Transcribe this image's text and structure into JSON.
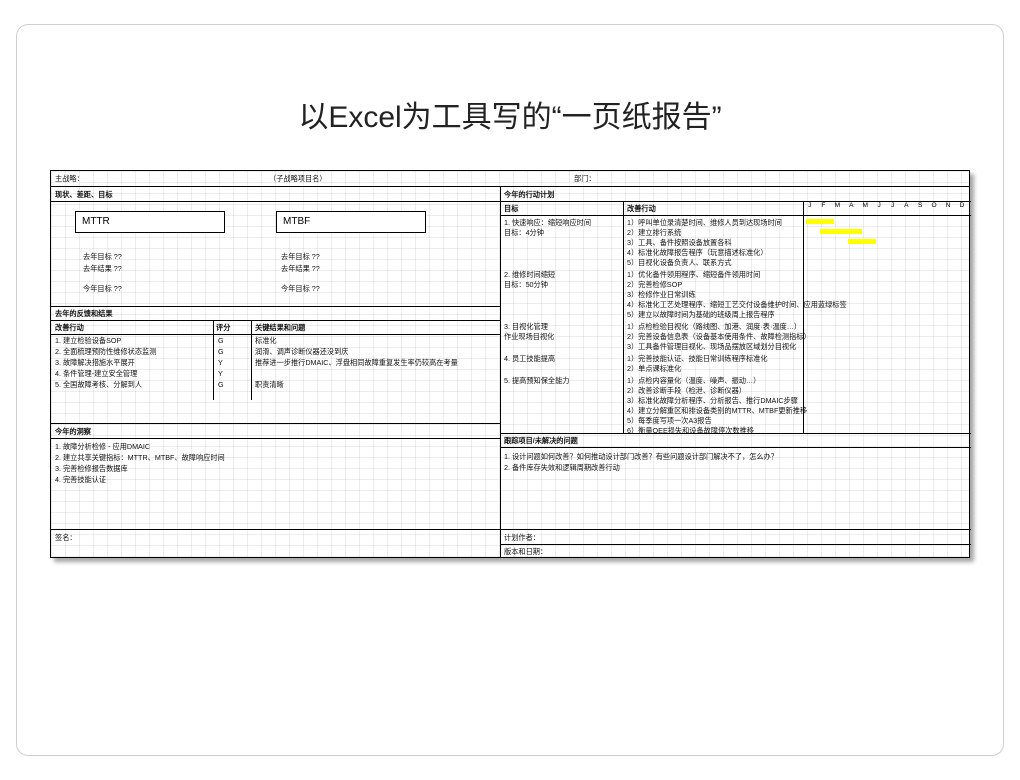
{
  "title": "以Excel为工具写的“一页纸报告”",
  "header": {
    "strategy_label": "主战略：",
    "strategy_value": "（子战略项目名）",
    "dept_label": "部门："
  },
  "left": {
    "s1_header": "现状、差距、目标",
    "mttr": "MTTR",
    "mtbf": "MTBF",
    "last_target_a": "去年目标  ??",
    "last_result_a": "去年结果  ??",
    "this_target_a": "今年目标  ??",
    "last_target_b": "去年目标  ??",
    "last_result_b": "去年结果  ??",
    "this_target_b": "今年目标  ??",
    "s2_header": "去年的反馈和结果",
    "s2_c1": "改善行动",
    "s2_c2": "评分",
    "s2_c3": "关键结果和问题",
    "s2_rows": [
      {
        "a": "1. 建立检验设备SOP",
        "b": "G",
        "c": "标准化"
      },
      {
        "a": "2. 全面梳理预防性维修状态监测",
        "b": "G",
        "c": "润滑、调声诊断仪器还没到庆"
      },
      {
        "a": "3. 故障解决措施水平展开",
        "b": "Y",
        "c": "推荐进一步推行DMAIC、浮盘相同故障重复发生率仍较高在考量"
      },
      {
        "a": "4. 条件管理-建立安全管理",
        "b": "Y",
        "c": ""
      },
      {
        "a": "5. 全国故障考核、分解到人",
        "b": "G",
        "c": "职责清晰"
      }
    ],
    "s3_header": "今年的洞察",
    "s3_rows": [
      "1. 故障分析检修 - 应用DMAIC",
      "2. 建立共享关键指标：MTTR、MTBF、故障响应时间",
      "3. 完善检修报告数据库",
      "4. 完善技能认证"
    ],
    "sign_label": "签名："
  },
  "right": {
    "s1_header": "今年的行动计划",
    "c1": "目标",
    "c2": "改善行动",
    "months": [
      "J",
      "F",
      "M",
      "A",
      "M",
      "J",
      "J",
      "A",
      "S",
      "O",
      "N",
      "D"
    ],
    "goals": [
      {
        "name": "1. 快速响应：缩短响应时间",
        "target": "    目标：4分钟",
        "actions": [
          "1）呼叫单位录清楚时间、维修人员到达现场时间",
          "2）建立排行系统",
          "3）工具、备件按照设备放置各科",
          "4）标准化故障报告程序（玩意描述标准化）",
          "5）目视化设备负责人、联系方式"
        ]
      },
      {
        "name": "2. 维修时间缩短",
        "target": "    目标：50分钟",
        "actions": [
          "1）优化备件领用程序、缩短备件领用时间",
          "2）完善检修SOP",
          "3）检修作业日常训练",
          "4）标准化工艺处理程序、缩短工艺交付设备维护时间、应用蓝绿标签",
          "5）建立以故障时间为基础的班级周上报告程序"
        ]
      },
      {
        "name": "3. 目视化管理",
        "target": "    作业现场目视化",
        "actions": [
          "1）点检检验目视化（路线图、加港、润度·表·温度…）",
          "2）完善设备信息表（设备基本使用条件、故障检测指标）",
          "3）工具备件管理目视化、现场品摆放区域划分目视化"
        ]
      },
      {
        "name": "4. 员工技能提高",
        "target": "",
        "actions": [
          "1）完善技能认证、技能日常训练程序标准化",
          "2）单点课标准化"
        ]
      },
      {
        "name": "5. 提高预知保全能力",
        "target": "",
        "actions": [
          "1）点检内容量化（温度、噪声、振动…）",
          "2）改善诊断手段（检泄、诊断仪器）",
          "3）标准化故障分析程序、分析报告、推行DMAIC步骤",
          "4）建立分解重区和排设备类别的MTTR、MTBF更新推移",
          "5）每季度写项一次A3报告",
          "6）衡量OEE损失和设备故障停次数推移"
        ]
      }
    ],
    "s2_header": "跟踪项目/未解决的问题",
    "s2_rows": [
      "1. 设计问题如何改善？如何推动设计部门改善？有些问题设计部门解决不了，怎么办？",
      "2. 备件库存失效和逻辑周期改善行动"
    ],
    "author_label": "计划作者：",
    "update_label": "版本和日期："
  }
}
